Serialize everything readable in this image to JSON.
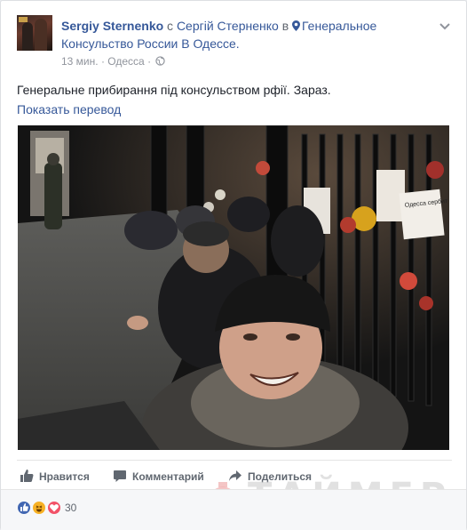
{
  "post": {
    "author": "Sergiy Sternenko",
    "with_word": "с",
    "with_person": "Сергій Стерненко",
    "in_word": "в",
    "place": "Генеральное Консульство России В Одессе.",
    "time": "13 мин.",
    "separator": "·",
    "location": "Одесса",
    "separator2": "·",
    "text": "Генеральне прибирання під консульством рфії. Зараз.",
    "translate_link": "Показать перевод",
    "photo_sign_text": "Одесса сербит со всей Россией"
  },
  "actions": {
    "like": "Нравится",
    "comment": "Комментарий",
    "share": "Поделиться"
  },
  "reactions": {
    "count": "30",
    "icons": [
      "like-reaction",
      "haha-reaction",
      "love-reaction"
    ],
    "colors": {
      "like": "#4267b2",
      "haha": "#f7b125",
      "love": "#f25268"
    }
  },
  "watermark": {
    "text": "ТАЙМЕР"
  },
  "colors": {
    "link": "#365899",
    "muted": "#90949c",
    "text": "#1d2129"
  }
}
